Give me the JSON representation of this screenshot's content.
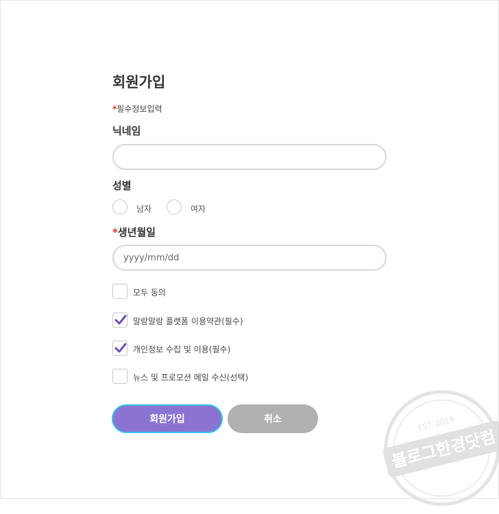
{
  "form": {
    "title": "회원가입",
    "required_mark": "*",
    "required_note": "필수정보입력",
    "nickname": {
      "label": "닉네임",
      "value": "",
      "placeholder": ""
    },
    "gender": {
      "label": "성별",
      "options": [
        {
          "label": "남자",
          "selected": false
        },
        {
          "label": "여자",
          "selected": false
        }
      ]
    },
    "birthdate": {
      "label": "생년월일",
      "value": "",
      "placeholder": "yyyy/mm/dd"
    },
    "agreements": [
      {
        "label": "모두 동의",
        "checked": false
      },
      {
        "label": "말랑말랑 플랫폼 이용약관(필수)",
        "checked": true
      },
      {
        "label": "개인정보 수집 및 이용(필수)",
        "checked": true
      },
      {
        "label": "뉴스 및 프로모션 메일 수신(선택)",
        "checked": false
      }
    ],
    "buttons": {
      "join": "회원가입",
      "cancel": "취소"
    }
  },
  "watermark": {
    "text": "블로그한경닷컴",
    "year": "EST. 2019"
  },
  "colors": {
    "accent": "#8b73d1",
    "check": "#6a4fb0",
    "focus_border": "#34c4ea",
    "cancel": "#b0b0b0",
    "required": "#dd3333"
  }
}
